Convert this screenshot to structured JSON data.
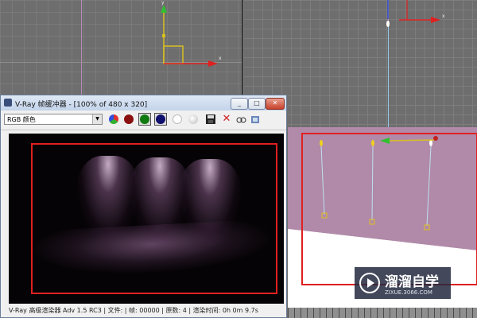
{
  "vfb": {
    "title": "V-Ray 帧缓冲器 - [100% of 480 x 320]",
    "channel": "RGB 颜色",
    "window_buttons": [
      "_",
      "□",
      "✕"
    ],
    "status": "V-Ray 高级渲染器 Adv 1.5 RC3 | 文件: | 帧: 00000 | 原数: 4 | 渲染时间: 0h 0m 9.7s"
  },
  "viewports": {
    "top_axis": {
      "x": "x",
      "y": "y"
    },
    "front_axis": {
      "x": "x",
      "y": "y"
    }
  },
  "watermark": {
    "brand": "溜溜自学",
    "url": "ZIXUE.3066.COM"
  },
  "colors": {
    "region": "#e02020",
    "axis_x": "#e02020",
    "axis_y": "#30c030",
    "gizmo": "#d8c020"
  }
}
